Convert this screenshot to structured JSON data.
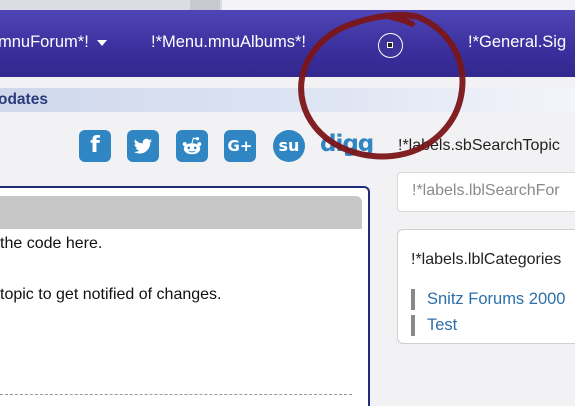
{
  "nav": {
    "forum_label": "mnuForum*!",
    "albums_label": "!*Menu.mnuAlbums*!",
    "general_label": "!*General.Sig"
  },
  "updates_bar": {
    "text": "odates"
  },
  "social": {
    "items": [
      {
        "name": "facebook-icon",
        "glyph": "f"
      },
      {
        "name": "twitter-icon"
      },
      {
        "name": "reddit-icon"
      },
      {
        "name": "google-plus-icon",
        "glyph": "G+"
      },
      {
        "name": "stumbleupon-icon",
        "glyph": "su"
      },
      {
        "name": "digg-icon",
        "glyph": "digg"
      }
    ],
    "color": "#2f86c3"
  },
  "sidebar": {
    "search_label": "!*labels.sbSearchTopic",
    "search_placeholder": "!*labels.lblSearchFor",
    "categories_title": "!*labels.lblCategories",
    "categories": [
      "Snitz Forums 2000",
      "Test"
    ]
  },
  "post": {
    "line1": " the code here.",
    "line2": "topic to get notified of changes."
  },
  "colors": {
    "navbar": "#3a2f9c",
    "annotation": "#7a1518",
    "link": "#2d6fa8"
  }
}
